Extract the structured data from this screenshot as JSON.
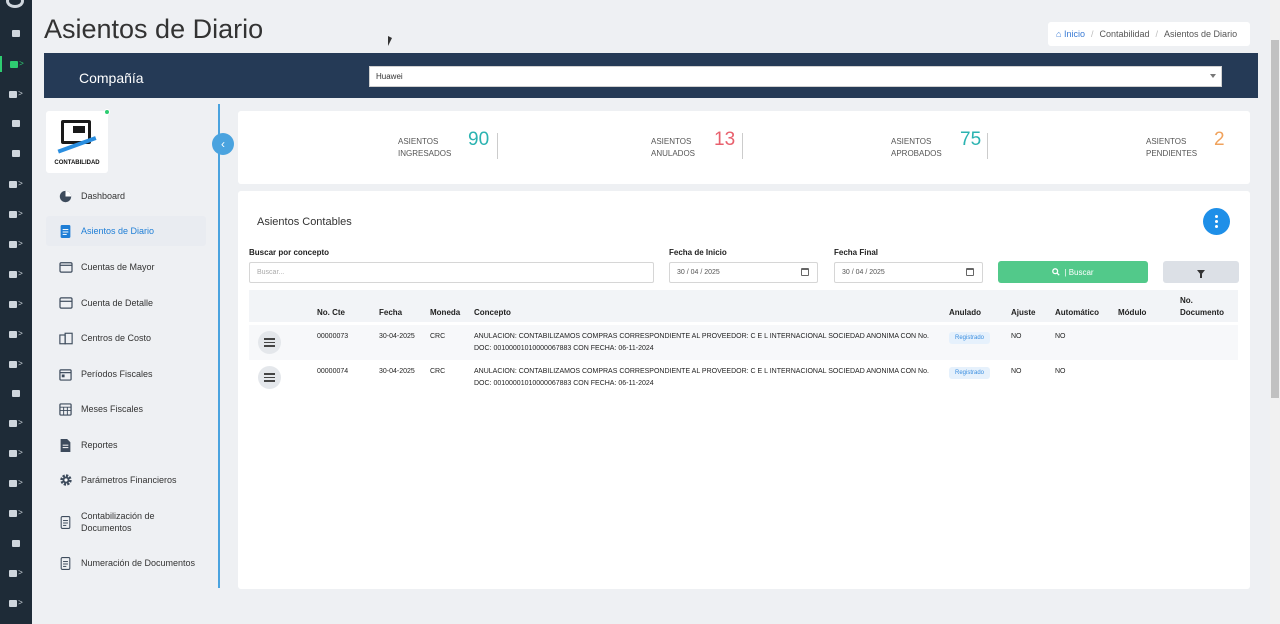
{
  "page_title": "Asientos de Diario",
  "breadcrumb": {
    "home": "Inicio",
    "section": "Contabilidad",
    "current": "Asientos de Diario"
  },
  "company": {
    "label": "Compañía",
    "selected": "Huawei"
  },
  "logo_text": "CONTABILIDAD",
  "sidebar": {
    "items": [
      {
        "label": "Dashboard",
        "icon": "pie-chart-icon"
      },
      {
        "label": "Asientos de Diario",
        "icon": "document-icon",
        "active": true
      },
      {
        "label": "Cuentas de Mayor",
        "icon": "wallet-icon"
      },
      {
        "label": "Cuenta de Detalle",
        "icon": "card-icon"
      },
      {
        "label": "Centros de Costo",
        "icon": "building-icon"
      },
      {
        "label": "Períodos Fiscales",
        "icon": "calendar-icon"
      },
      {
        "label": "Meses Fiscales",
        "icon": "calendar-grid-icon"
      },
      {
        "label": "Reportes",
        "icon": "file-icon"
      },
      {
        "label": "Parámetros Financieros",
        "icon": "gear-icon"
      },
      {
        "label": "Contabilización de Documentos",
        "icon": "document-icon"
      },
      {
        "label": "Numeración de Documentos",
        "icon": "document-icon"
      }
    ]
  },
  "stats": [
    {
      "label": "ASIENTOS INGRESADOS",
      "value": "90",
      "color": "#2bb3b1"
    },
    {
      "label": "ASIENTOS ANULADOS",
      "value": "13",
      "color": "#e8606d"
    },
    {
      "label": "ASIENTOS APROBADOS",
      "value": "75",
      "color": "#2bb3b1"
    },
    {
      "label": "ASIENTOS PENDIENTES",
      "value": "2",
      "color": "#f0a25c"
    }
  ],
  "card_title": "Asientos Contables",
  "filters": {
    "concept_label": "Buscar por concepto",
    "concept_placeholder": "Buscar...",
    "start_label": "Fecha de Inicio",
    "start_value": "30 / 04 / 2025",
    "end_label": "Fecha Final",
    "end_value": "30 / 04 / 2025",
    "search_button": "| Buscar"
  },
  "table": {
    "headers": {
      "no_cte": "No. Cte",
      "fecha": "Fecha",
      "moneda": "Moneda",
      "concepto": "Concepto",
      "anulado": "Anulado",
      "ajuste": "Ajuste",
      "automatico": "Automático",
      "modulo": "Módulo",
      "no_documento": "No. Documento"
    },
    "rows": [
      {
        "no_cte": "00000073",
        "fecha": "30-04-2025",
        "moneda": "CRC",
        "concepto": "ANULACION: CONTABILIZAMOS COMPRAS CORRESPONDIENTE AL PROVEEDOR: C E L INTERNACIONAL SOCIEDAD ANONIMA CON No. DOC: 00100001010000067883 CON FECHA: 06-11-2024",
        "anulado": "Registrado",
        "ajuste": "NO",
        "automatico": "NO",
        "modulo": "",
        "no_documento": ""
      },
      {
        "no_cte": "00000074",
        "fecha": "30-04-2025",
        "moneda": "CRC",
        "concepto": "ANULACION: CONTABILIZAMOS COMPRAS CORRESPONDIENTE AL PROVEEDOR: C E L INTERNACIONAL SOCIEDAD ANONIMA CON No. DOC: 00100001010000067883 CON FECHA: 06-11-2024",
        "anulado": "Registrado",
        "ajuste": "NO",
        "automatico": "NO",
        "modulo": "",
        "no_documento": ""
      }
    ]
  }
}
